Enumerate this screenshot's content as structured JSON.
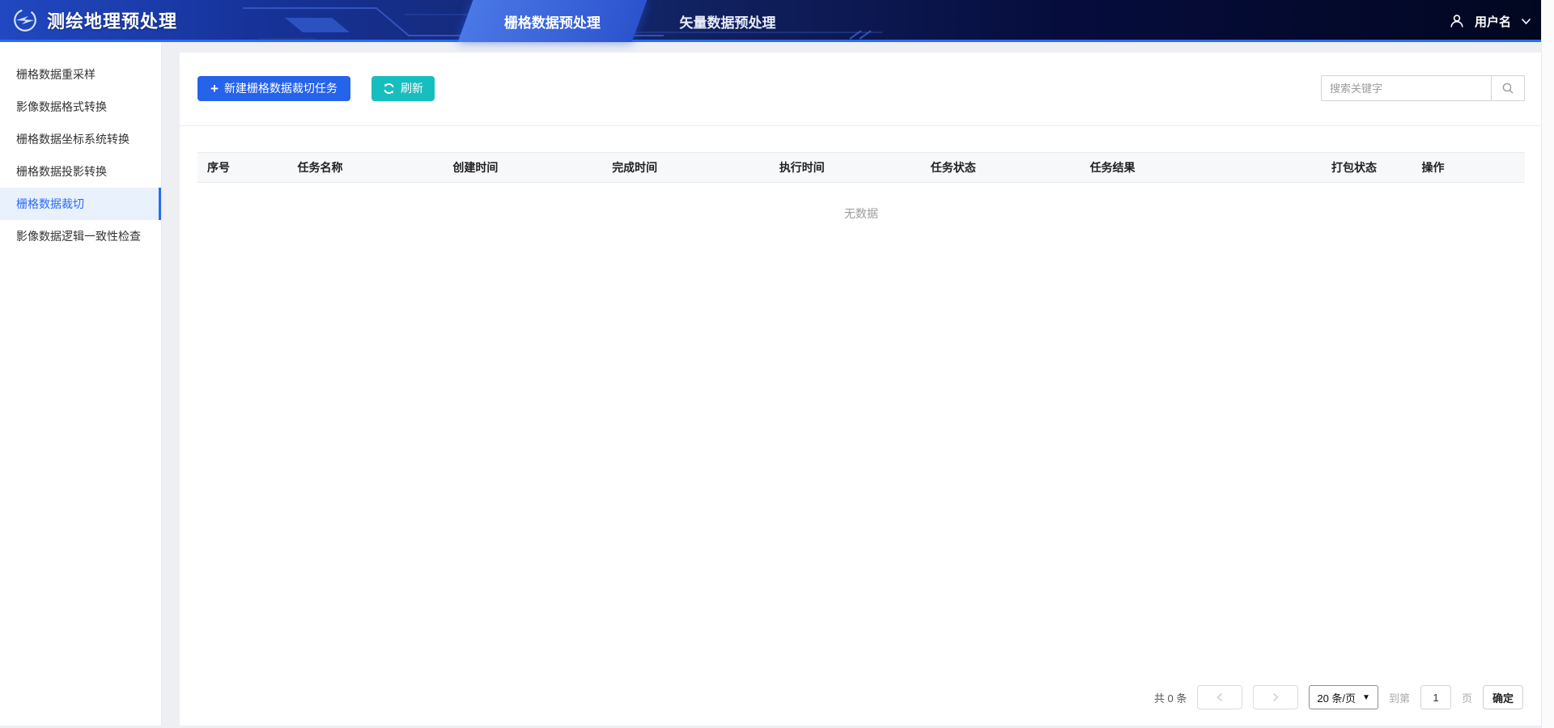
{
  "app": {
    "title": "测绘地理预处理"
  },
  "header": {
    "tabs": [
      {
        "label": "栅格数据预处理",
        "active": true
      },
      {
        "label": "矢量数据预处理",
        "active": false
      }
    ],
    "user": {
      "name": "用户名"
    }
  },
  "sidebar": {
    "items": [
      {
        "label": "栅格数据重采样",
        "active": false
      },
      {
        "label": "影像数据格式转换",
        "active": false
      },
      {
        "label": "栅格数据坐标系统转换",
        "active": false
      },
      {
        "label": "栅格数据投影转换",
        "active": false
      },
      {
        "label": "栅格数据裁切",
        "active": true
      },
      {
        "label": "影像数据逻辑一致性检查",
        "active": false
      }
    ]
  },
  "toolbar": {
    "new_task_label": "新建栅格数据裁切任务",
    "refresh_label": "刷新",
    "search_placeholder": "搜索关键字"
  },
  "table": {
    "columns": [
      "序号",
      "任务名称",
      "创建时间",
      "完成时间",
      "执行时间",
      "任务状态",
      "任务结果",
      "打包状态",
      "操作"
    ],
    "rows": [],
    "empty_text": "无数据"
  },
  "pagination": {
    "total_text": "共 0 条",
    "page_size_label": "20 条/页",
    "goto_prefix": "到第",
    "goto_value": "1",
    "goto_suffix": "页",
    "confirm_label": "确定"
  },
  "colors": {
    "accent": "#2a6af5",
    "primary_button": "#2563eb",
    "refresh_button": "#17bebe",
    "header_left": "#2148c1",
    "header_right": "#020720",
    "sidebar_active_bg": "#e9f1fd"
  }
}
